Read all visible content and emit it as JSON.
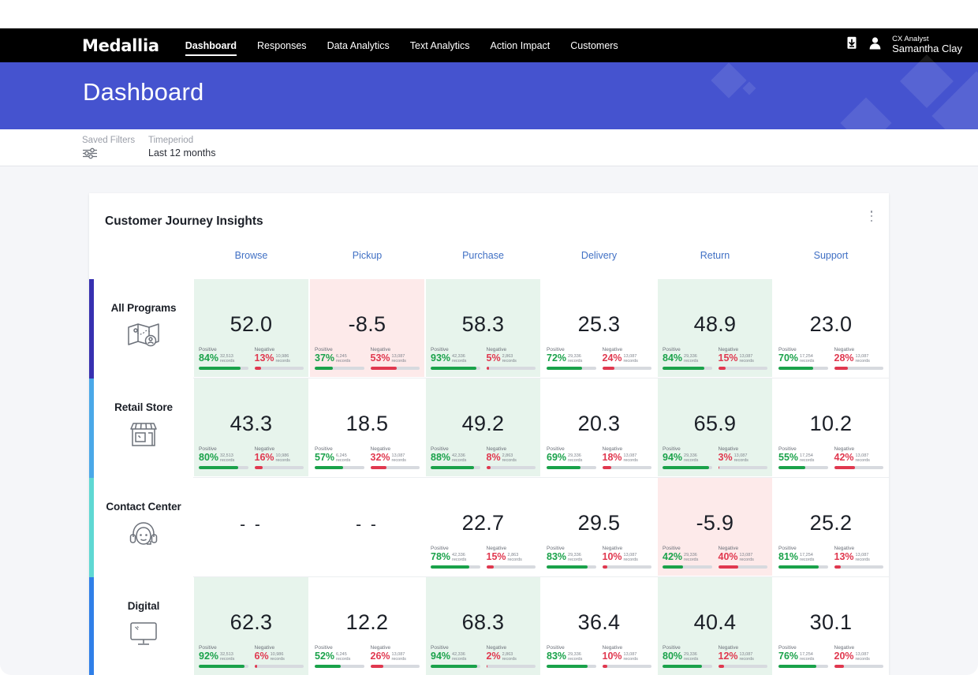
{
  "nav": {
    "brand": "Medallia",
    "links": [
      {
        "label": "Dashboard",
        "active": true
      },
      {
        "label": "Responses",
        "active": false
      },
      {
        "label": "Data Analytics",
        "active": false
      },
      {
        "label": "Text Analytics",
        "active": false
      },
      {
        "label": "Action Impact",
        "active": false
      },
      {
        "label": "Customers",
        "active": false
      }
    ],
    "download_icon": "download-icon",
    "user_icon": "user-avatar-icon",
    "user_role": "CX Analyst",
    "user_name": "Samantha Clay"
  },
  "banner": {
    "title": "Dashboard",
    "color": "#4553cf"
  },
  "filters": [
    {
      "label": "Saved Filters",
      "value": "",
      "icon": "sliders-icon"
    },
    {
      "label": "Timeperiod",
      "value": "Last 12 months",
      "icon": ""
    }
  ],
  "card": {
    "title": "Customer Journey Insights",
    "menu_icon": "kebab-menu-icon"
  },
  "chart_data": {
    "type": "heatmap",
    "title": "Customer Journey Insights",
    "legend_position": "none",
    "grid": true,
    "metric_labels": {
      "positive": "Positive",
      "negative": "Negative",
      "records_suffix": "records",
      "empty": "- -"
    },
    "colors": {
      "positive_cell": "#e7f4ec",
      "negative_cell": "#fdeaea",
      "neutral_cell": "#ffffff",
      "positive_bar": "#1aa24a",
      "negative_bar": "#e0384f",
      "column_header": "#4070c4"
    },
    "categories": [
      "Browse",
      "Pickup",
      "Purchase",
      "Delivery",
      "Return",
      "Support"
    ],
    "rows": [
      {
        "name": "All Programs",
        "icon": "map-journey-icon",
        "bar_color": "#3730b0",
        "cells": [
          {
            "score": "52.0",
            "tone": "pos",
            "positive_pct": "84%",
            "positive_records": "32,513",
            "negative_pct": "13%",
            "negative_records": "10,986"
          },
          {
            "score": "-8.5",
            "tone": "neg",
            "positive_pct": "37%",
            "positive_records": "6,245",
            "negative_pct": "53%",
            "negative_records": "13,087"
          },
          {
            "score": "58.3",
            "tone": "pos",
            "positive_pct": "93%",
            "positive_records": "42,336",
            "negative_pct": "5%",
            "negative_records": "2,863"
          },
          {
            "score": "25.3",
            "tone": "neutral",
            "positive_pct": "72%",
            "positive_records": "29,336",
            "negative_pct": "24%",
            "negative_records": "13,087"
          },
          {
            "score": "48.9",
            "tone": "pos",
            "positive_pct": "84%",
            "positive_records": "29,336",
            "negative_pct": "15%",
            "negative_records": "13,087"
          },
          {
            "score": "23.0",
            "tone": "neutral",
            "positive_pct": "70%",
            "positive_records": "17,254",
            "negative_pct": "28%",
            "negative_records": "13,087"
          }
        ]
      },
      {
        "name": "Retail Store",
        "icon": "storefront-icon",
        "bar_color": "#4aa8e8",
        "cells": [
          {
            "score": "43.3",
            "tone": "pos",
            "positive_pct": "80%",
            "positive_records": "32,513",
            "negative_pct": "16%",
            "negative_records": "10,986"
          },
          {
            "score": "18.5",
            "tone": "neutral",
            "positive_pct": "57%",
            "positive_records": "6,245",
            "negative_pct": "32%",
            "negative_records": "13,087"
          },
          {
            "score": "49.2",
            "tone": "pos",
            "positive_pct": "88%",
            "positive_records": "42,336",
            "negative_pct": "8%",
            "negative_records": "2,863"
          },
          {
            "score": "20.3",
            "tone": "neutral",
            "positive_pct": "69%",
            "positive_records": "29,336",
            "negative_pct": "18%",
            "negative_records": "13,087"
          },
          {
            "score": "65.9",
            "tone": "pos",
            "positive_pct": "94%",
            "positive_records": "29,336",
            "negative_pct": "3%",
            "negative_records": "13,087"
          },
          {
            "score": "10.2",
            "tone": "neutral",
            "positive_pct": "55%",
            "positive_records": "17,254",
            "negative_pct": "42%",
            "negative_records": "13,087"
          }
        ]
      },
      {
        "name": "Contact Center",
        "icon": "headset-agent-icon",
        "bar_color": "#5fd8d3",
        "cells": [
          {
            "score": "- -",
            "tone": "neutral",
            "empty": true
          },
          {
            "score": "- -",
            "tone": "neutral",
            "empty": true
          },
          {
            "score": "22.7",
            "tone": "neutral",
            "positive_pct": "78%",
            "positive_records": "42,336",
            "negative_pct": "15%",
            "negative_records": "2,863"
          },
          {
            "score": "29.5",
            "tone": "neutral",
            "positive_pct": "83%",
            "positive_records": "29,336",
            "negative_pct": "10%",
            "negative_records": "13,087"
          },
          {
            "score": "-5.9",
            "tone": "neg",
            "positive_pct": "42%",
            "positive_records": "29,336",
            "negative_pct": "40%",
            "negative_records": "13,087"
          },
          {
            "score": "25.2",
            "tone": "neutral",
            "positive_pct": "81%",
            "positive_records": "17,254",
            "negative_pct": "13%",
            "negative_records": "13,087"
          }
        ]
      },
      {
        "name": "Digital",
        "icon": "monitor-icon",
        "bar_color": "#2f7fe8",
        "cells": [
          {
            "score": "62.3",
            "tone": "pos",
            "positive_pct": "92%",
            "positive_records": "32,513",
            "negative_pct": "6%",
            "negative_records": "10,986"
          },
          {
            "score": "12.2",
            "tone": "neutral",
            "positive_pct": "52%",
            "positive_records": "6,245",
            "negative_pct": "26%",
            "negative_records": "13,087"
          },
          {
            "score": "68.3",
            "tone": "pos",
            "positive_pct": "94%",
            "positive_records": "42,336",
            "negative_pct": "2%",
            "negative_records": "2,863"
          },
          {
            "score": "36.4",
            "tone": "neutral",
            "positive_pct": "83%",
            "positive_records": "29,336",
            "negative_pct": "10%",
            "negative_records": "13,087"
          },
          {
            "score": "40.4",
            "tone": "pos",
            "positive_pct": "80%",
            "positive_records": "29,336",
            "negative_pct": "12%",
            "negative_records": "13,087"
          },
          {
            "score": "30.1",
            "tone": "neutral",
            "positive_pct": "76%",
            "positive_records": "17,254",
            "negative_pct": "20%",
            "negative_records": "13,087"
          }
        ]
      }
    ]
  }
}
